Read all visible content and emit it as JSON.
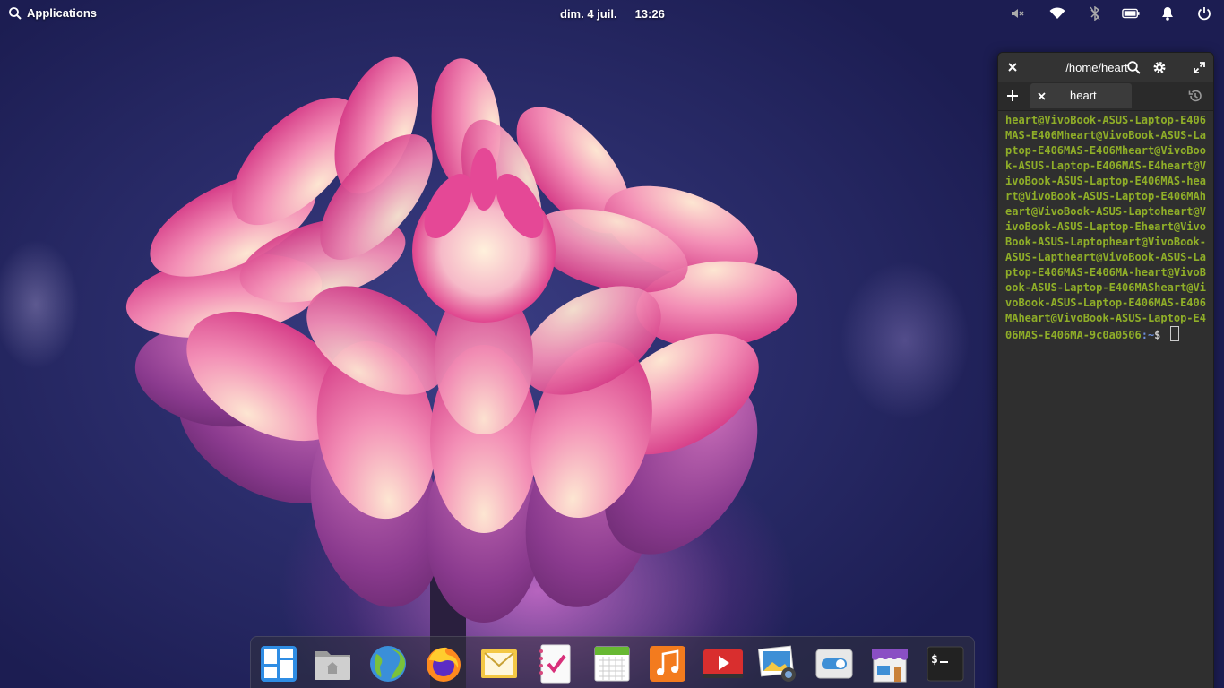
{
  "panel": {
    "applications_label": "Applications",
    "date": "dim. 4 juil.",
    "time": "13:26",
    "tray": [
      "volume-muted-icon",
      "wifi-icon",
      "bluetooth-icon",
      "battery-icon",
      "notifications-icon",
      "power-icon"
    ]
  },
  "terminal": {
    "title": "/home/heart",
    "tab_label": "heart",
    "output": "heart@VivoBook-ASUS-Laptop-E406MAS-E406Mheart@VivoBook-ASUS-Laptop-E406MAS-E406Mheart@VivoBook-ASUS-Laptop-E406MAS-E4heart@VivoBook-ASUS-Laptop-E406MAS-heart@VivoBook-ASUS-Laptop-E406MAheart@VivoBook-ASUS-Laptoheart@VivoBook-ASUS-Laptop-Eheart@VivoBook-ASUS-Laptopheart@VivoBook-ASUS-Laptheart@VivoBook-ASUS-Laptop-E406MAS-E406MA-heart@VivoBook-ASUS-Laptop-E406MASheart@VivoBook-ASUS-Laptop-E406MAS-E406MAheart@VivoBook-ASUS-Laptop-E406MAS-E406MA-9c0a0506",
    "prompt_path": ":~",
    "prompt_symbol": "$ "
  },
  "dock": {
    "items": [
      "multitasking-view",
      "files",
      "web-browser",
      "firefox",
      "mail",
      "tasks",
      "calendar",
      "music",
      "videos",
      "photos",
      "system-settings",
      "appcenter",
      "terminal"
    ]
  },
  "colors": {
    "terminal_bg": "#2f2f2f",
    "terminal_text": "#8fae28",
    "prompt_path": "#6c8ed8"
  }
}
